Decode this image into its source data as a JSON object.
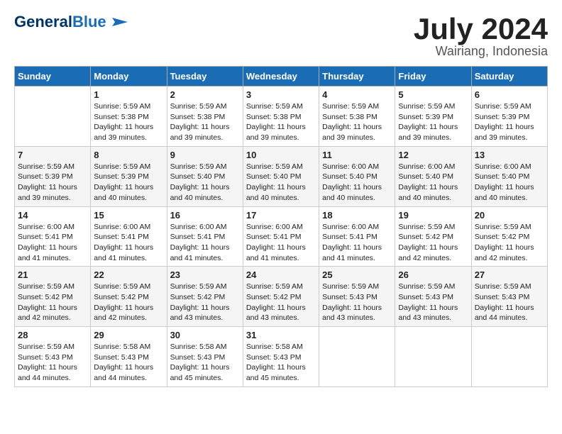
{
  "header": {
    "logo_line1": "General",
    "logo_line2": "Blue",
    "title": "July 2024",
    "subtitle": "Wairiang, Indonesia"
  },
  "days_of_week": [
    "Sunday",
    "Monday",
    "Tuesday",
    "Wednesday",
    "Thursday",
    "Friday",
    "Saturday"
  ],
  "weeks": [
    [
      {
        "day": "",
        "info": ""
      },
      {
        "day": "1",
        "info": "Sunrise: 5:59 AM\nSunset: 5:38 PM\nDaylight: 11 hours\nand 39 minutes."
      },
      {
        "day": "2",
        "info": "Sunrise: 5:59 AM\nSunset: 5:38 PM\nDaylight: 11 hours\nand 39 minutes."
      },
      {
        "day": "3",
        "info": "Sunrise: 5:59 AM\nSunset: 5:38 PM\nDaylight: 11 hours\nand 39 minutes."
      },
      {
        "day": "4",
        "info": "Sunrise: 5:59 AM\nSunset: 5:38 PM\nDaylight: 11 hours\nand 39 minutes."
      },
      {
        "day": "5",
        "info": "Sunrise: 5:59 AM\nSunset: 5:39 PM\nDaylight: 11 hours\nand 39 minutes."
      },
      {
        "day": "6",
        "info": "Sunrise: 5:59 AM\nSunset: 5:39 PM\nDaylight: 11 hours\nand 39 minutes."
      }
    ],
    [
      {
        "day": "7",
        "info": "Sunrise: 5:59 AM\nSunset: 5:39 PM\nDaylight: 11 hours\nand 39 minutes."
      },
      {
        "day": "8",
        "info": "Sunrise: 5:59 AM\nSunset: 5:39 PM\nDaylight: 11 hours\nand 40 minutes."
      },
      {
        "day": "9",
        "info": "Sunrise: 5:59 AM\nSunset: 5:40 PM\nDaylight: 11 hours\nand 40 minutes."
      },
      {
        "day": "10",
        "info": "Sunrise: 5:59 AM\nSunset: 5:40 PM\nDaylight: 11 hours\nand 40 minutes."
      },
      {
        "day": "11",
        "info": "Sunrise: 6:00 AM\nSunset: 5:40 PM\nDaylight: 11 hours\nand 40 minutes."
      },
      {
        "day": "12",
        "info": "Sunrise: 6:00 AM\nSunset: 5:40 PM\nDaylight: 11 hours\nand 40 minutes."
      },
      {
        "day": "13",
        "info": "Sunrise: 6:00 AM\nSunset: 5:40 PM\nDaylight: 11 hours\nand 40 minutes."
      }
    ],
    [
      {
        "day": "14",
        "info": "Sunrise: 6:00 AM\nSunset: 5:41 PM\nDaylight: 11 hours\nand 41 minutes."
      },
      {
        "day": "15",
        "info": "Sunrise: 6:00 AM\nSunset: 5:41 PM\nDaylight: 11 hours\nand 41 minutes."
      },
      {
        "day": "16",
        "info": "Sunrise: 6:00 AM\nSunset: 5:41 PM\nDaylight: 11 hours\nand 41 minutes."
      },
      {
        "day": "17",
        "info": "Sunrise: 6:00 AM\nSunset: 5:41 PM\nDaylight: 11 hours\nand 41 minutes."
      },
      {
        "day": "18",
        "info": "Sunrise: 6:00 AM\nSunset: 5:41 PM\nDaylight: 11 hours\nand 41 minutes."
      },
      {
        "day": "19",
        "info": "Sunrise: 5:59 AM\nSunset: 5:42 PM\nDaylight: 11 hours\nand 42 minutes."
      },
      {
        "day": "20",
        "info": "Sunrise: 5:59 AM\nSunset: 5:42 PM\nDaylight: 11 hours\nand 42 minutes."
      }
    ],
    [
      {
        "day": "21",
        "info": "Sunrise: 5:59 AM\nSunset: 5:42 PM\nDaylight: 11 hours\nand 42 minutes."
      },
      {
        "day": "22",
        "info": "Sunrise: 5:59 AM\nSunset: 5:42 PM\nDaylight: 11 hours\nand 42 minutes."
      },
      {
        "day": "23",
        "info": "Sunrise: 5:59 AM\nSunset: 5:42 PM\nDaylight: 11 hours\nand 43 minutes."
      },
      {
        "day": "24",
        "info": "Sunrise: 5:59 AM\nSunset: 5:42 PM\nDaylight: 11 hours\nand 43 minutes."
      },
      {
        "day": "25",
        "info": "Sunrise: 5:59 AM\nSunset: 5:43 PM\nDaylight: 11 hours\nand 43 minutes."
      },
      {
        "day": "26",
        "info": "Sunrise: 5:59 AM\nSunset: 5:43 PM\nDaylight: 11 hours\nand 43 minutes."
      },
      {
        "day": "27",
        "info": "Sunrise: 5:59 AM\nSunset: 5:43 PM\nDaylight: 11 hours\nand 44 minutes."
      }
    ],
    [
      {
        "day": "28",
        "info": "Sunrise: 5:59 AM\nSunset: 5:43 PM\nDaylight: 11 hours\nand 44 minutes."
      },
      {
        "day": "29",
        "info": "Sunrise: 5:58 AM\nSunset: 5:43 PM\nDaylight: 11 hours\nand 44 minutes."
      },
      {
        "day": "30",
        "info": "Sunrise: 5:58 AM\nSunset: 5:43 PM\nDaylight: 11 hours\nand 45 minutes."
      },
      {
        "day": "31",
        "info": "Sunrise: 5:58 AM\nSunset: 5:43 PM\nDaylight: 11 hours\nand 45 minutes."
      },
      {
        "day": "",
        "info": ""
      },
      {
        "day": "",
        "info": ""
      },
      {
        "day": "",
        "info": ""
      }
    ]
  ]
}
